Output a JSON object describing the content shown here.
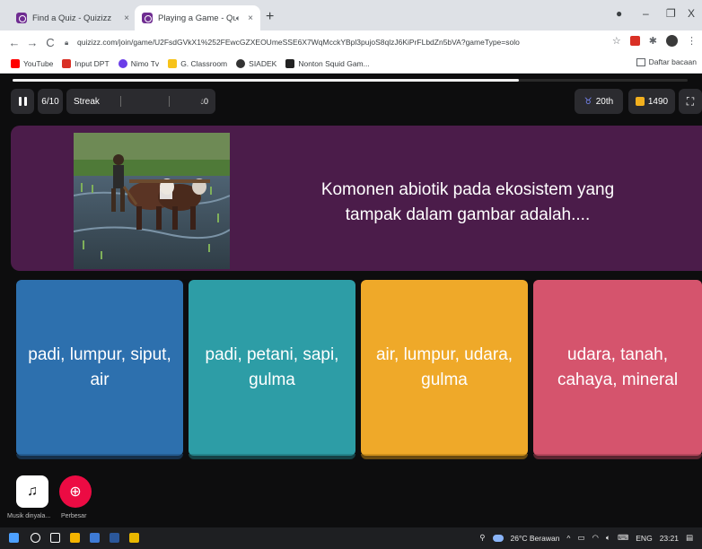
{
  "browser": {
    "tabs": [
      {
        "title": "Find a Quiz - Quizizz"
      },
      {
        "title": "Playing a Game - Quizizz"
      }
    ],
    "tab_close_symbol": "×",
    "new_tab_symbol": "+",
    "window_controls": [
      "–",
      "❐",
      "X"
    ],
    "url": "quizizz.com/join/game/U2FsdGVkX1%252FEwcGZXEOUmeSSE6X7WqMcckYBpl3pujoS8qlzJ6KiPrFLbdZn5bVA?gameType=solo",
    "bookmarks": [
      "YouTube",
      "Input DPT",
      "Nimo Tv",
      "G. Classroom",
      "SIADEK",
      "Nonton Squid Gam..."
    ],
    "bookmark_colors": [
      "#ff0000",
      "#d93025",
      "#6a3de8",
      "#f7c31a",
      "#333333",
      "#222222"
    ],
    "reading_list": "Daftar bacaan"
  },
  "hud": {
    "question_counter": "6/10",
    "streak_label": "Streak",
    "streak_value": "0",
    "rank": "20th",
    "score": "1490",
    "progress_fraction": 0.75
  },
  "question": {
    "text": "Komonen abiotik pada ekosistem yang tampak dalam gambar adalah...."
  },
  "answers": [
    {
      "text": "padi, lumpur, siput, air",
      "color": "#2d70ae"
    },
    {
      "text": "padi, petani, sapi, gulma",
      "color": "#2d9da6"
    },
    {
      "text": "air, lumpur, udara, gulma",
      "color": "#efa929"
    },
    {
      "text": "udara, tanah, cahaya, mineral",
      "color": "#d5546d"
    }
  ],
  "controls": {
    "music_label": "Musik dinyala...",
    "zoom_label": "Perbesar"
  },
  "taskbar": {
    "weather": "26°C Berawan",
    "language": "ENG",
    "time": "23:21"
  }
}
